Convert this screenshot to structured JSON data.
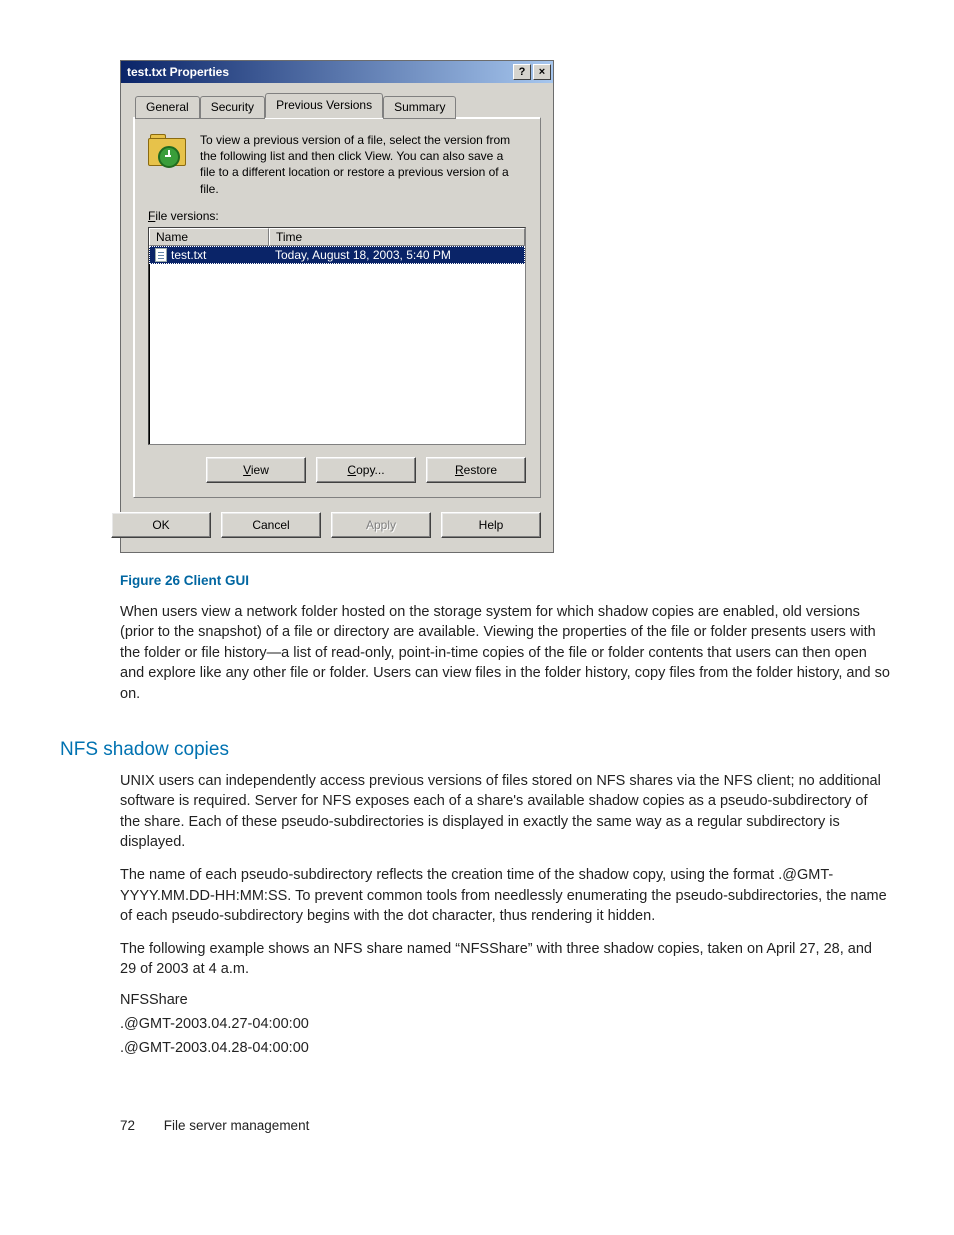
{
  "dialog": {
    "title": "test.txt Properties",
    "help_glyph": "?",
    "close_glyph": "×",
    "tabs": {
      "general": "General",
      "security": "Security",
      "previous": "Previous Versions",
      "summary": "Summary"
    },
    "intro": "To view a previous version of a file, select the version from the following list and then click View.  You can also save a file to a different location or restore a previous version of a file.",
    "file_versions_label_pre": "F",
    "file_versions_label_post": "ile versions:",
    "columns": {
      "name": "Name",
      "time": "Time"
    },
    "rows": [
      {
        "name": "test.txt",
        "time": "Today, August 18, 2003, 5:40 PM"
      }
    ],
    "buttons": {
      "view_pre": "V",
      "view_post": "iew",
      "copy_pre": "C",
      "copy_post": "opy...",
      "restore_pre": "R",
      "restore_post": "estore",
      "ok": "OK",
      "cancel": "Cancel",
      "apply": "Apply",
      "help": "Help"
    }
  },
  "caption": "Figure 26 Client GUI",
  "para1": "When users view a network folder hosted on the storage system for which shadow copies are enabled, old versions (prior to the snapshot) of a file or directory are available. Viewing the properties of the file or folder presents users with the folder or file history—a list of read-only, point-in-time copies of the file or folder contents that users can then open and explore like any other file or folder. Users can view files in the folder history, copy files from the folder history, and so on.",
  "heading": "NFS shadow copies",
  "para2": "UNIX users can independently access previous versions of files stored on NFS shares via the NFS client; no additional software is required. Server for NFS exposes each of a share's available shadow copies as a pseudo-subdirectory of the share. Each of these pseudo-subdirectories is displayed in exactly the same way as a regular subdirectory is displayed.",
  "para3": "The name of each pseudo-subdirectory reflects the creation time of the shadow copy, using the format .@GMT-YYYY.MM.DD-HH:MM:SS. To prevent common tools from needlessly enumerating the pseudo-subdirectories, the name of each pseudo-subdirectory begins with the dot character, thus rendering it hidden.",
  "para4": "The following example shows an NFS share named “NFSShare” with three shadow copies, taken on April 27, 28, and 29 of 2003 at 4 a.m.",
  "lines": {
    "l1": "NFSShare",
    "l2": ".@GMT-2003.04.27-04:00:00",
    "l3": ".@GMT-2003.04.28-04:00:00"
  },
  "footer": {
    "page": "72",
    "section": "File server management"
  }
}
